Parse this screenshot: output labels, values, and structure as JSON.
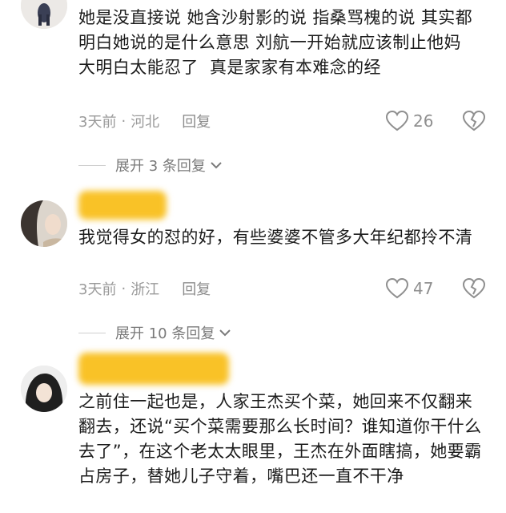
{
  "comments": [
    {
      "text": "她是没直接说 她含沙射影的说 指桑骂槐的说 其实都明白她说的是什么意思 刘航一开始就应该制止他妈  大明白太能忍了  真是家家有本难念的经",
      "time": "3天前",
      "location": "河北",
      "reply_label": "回复",
      "likes": "26",
      "expand_label": "展开 3 条回复"
    },
    {
      "text": "我觉得女的怼的好，有些婆婆不管多大年纪都拎不清",
      "time": "3天前",
      "location": "浙江",
      "reply_label": "回复",
      "likes": "47",
      "expand_label": "展开 10 条回复"
    },
    {
      "text": "之前住一起也是，人家王杰买个菜，她回来不仅翻来翻去，还说“买个菜需要那么长时间？谁知道你干什么去了”，在这个老太太眼里，王杰在外面瞎搞，她要霸占房子，替她儿子守着，嘴巴还一直不干净"
    }
  ],
  "colors": {
    "text": "#1c1c1c",
    "meta": "#9a9a9a",
    "redaction": "#f9c227",
    "background": "#ffffff"
  },
  "icons": {
    "like": "heart-outline-icon",
    "dislike": "broken-heart-icon",
    "expand": "chevron-down-icon"
  }
}
